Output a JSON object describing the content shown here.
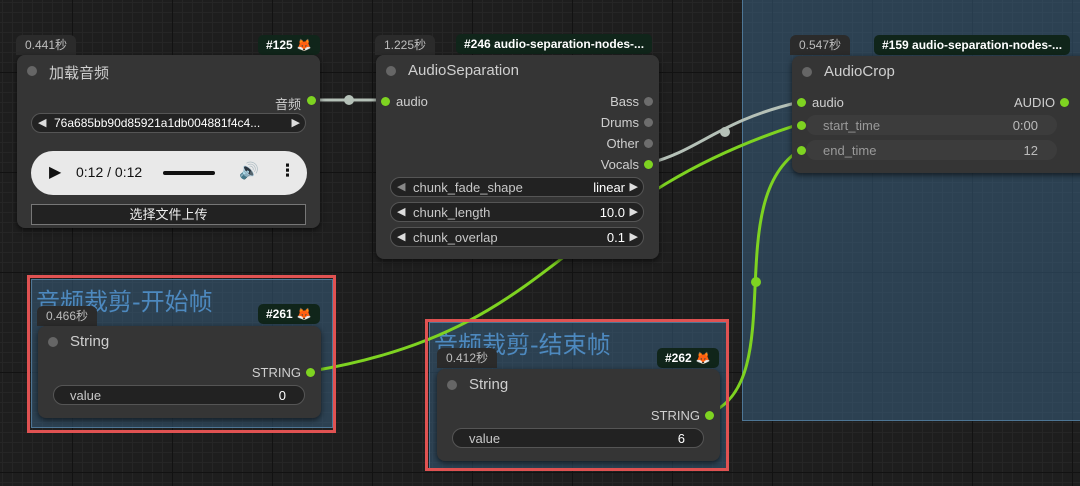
{
  "groups": {
    "start_title": "音频裁剪-开始帧",
    "end_title": "音频裁剪-结束帧"
  },
  "colors": {
    "link_green": "#7ed321",
    "link_grey": "#b5c1b8",
    "highlight_red": "#e05252",
    "group_blue": "#395e7e"
  },
  "load_audio": {
    "timer": "0.441秒",
    "badge": "#125",
    "badge_icon": "fox-icon",
    "title": "加载音频",
    "output_label": "音频",
    "file_value": "76a685bb90d85921a1db004881f4c4...",
    "player_time": "0:12 / 0:12",
    "upload_label": "选择文件上传"
  },
  "separation": {
    "timer": "1.225秒",
    "badge": "#246 audio-separation-nodes-...",
    "title": "AudioSeparation",
    "input_label": "audio",
    "outputs": [
      "Bass",
      "Drums",
      "Other",
      "Vocals"
    ],
    "widgets": [
      {
        "label": "chunk_fade_shape",
        "value": "linear"
      },
      {
        "label": "chunk_length",
        "value": "10.0"
      },
      {
        "label": "chunk_overlap",
        "value": "0.1"
      }
    ]
  },
  "crop": {
    "timer": "0.547秒",
    "badge": "#159 audio-separation-nodes-...",
    "title": "AudioCrop",
    "input_label": "audio",
    "output_label": "AUDIO",
    "widgets": [
      {
        "label": "start_time",
        "value": "0:00"
      },
      {
        "label": "end_time",
        "value": "12"
      }
    ]
  },
  "string_start": {
    "timer": "0.466秒",
    "badge": "#261",
    "title": "String",
    "output_label": "STRING",
    "widget_label": "value",
    "widget_value": "0"
  },
  "string_end": {
    "timer": "0.412秒",
    "badge": "#262",
    "title": "String",
    "output_label": "STRING",
    "widget_label": "value",
    "widget_value": "6"
  }
}
